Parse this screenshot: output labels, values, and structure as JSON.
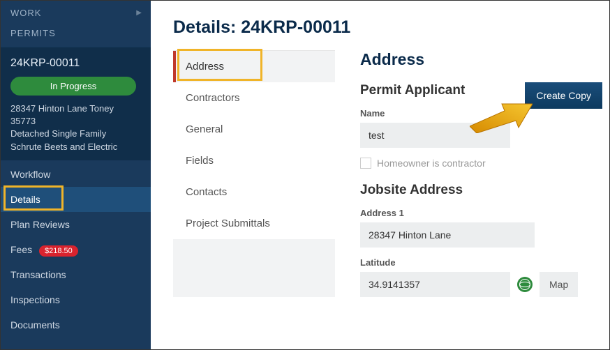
{
  "sidebar": {
    "header1": "WORK",
    "header2": "PERMITS",
    "permit": {
      "id": "24KRP-00011",
      "status": "In Progress",
      "address": "28347 Hinton Lane Toney 35773",
      "type": "Detached Single Family",
      "company": "Schrute Beets and Electric"
    },
    "nav": {
      "workflow": "Workflow",
      "details": "Details",
      "plan_reviews": "Plan Reviews",
      "fees": "Fees",
      "fees_badge": "$218.50",
      "transactions": "Transactions",
      "inspections": "Inspections",
      "documents": "Documents"
    }
  },
  "main": {
    "title": "Details: 24KRP-00011",
    "tabs": {
      "address": "Address",
      "contractors": "Contractors",
      "general": "General",
      "fields": "Fields",
      "contacts": "Contacts",
      "project_submittals": "Project Submittals"
    },
    "form": {
      "section_title": "Address",
      "applicant_title": "Permit Applicant",
      "name_label": "Name",
      "name_value": "test",
      "homeowner_label": "Homeowner is contractor",
      "jobsite_title": "Jobsite Address",
      "address1_label": "Address 1",
      "address1_value": "28347 Hinton Lane",
      "latitude_label": "Latitude",
      "latitude_value": "34.9141357",
      "map_label": "Map",
      "create_copy": "Create Copy"
    }
  }
}
